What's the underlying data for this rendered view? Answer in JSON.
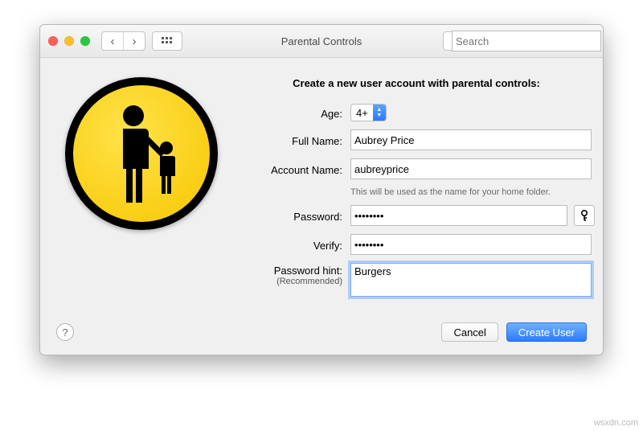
{
  "window": {
    "title": "Parental Controls",
    "search_placeholder": "Search"
  },
  "heading": "Create a new user account with parental controls:",
  "labels": {
    "age": "Age:",
    "full_name": "Full Name:",
    "account_name": "Account Name:",
    "account_hint": "This will be used as the name for your home folder.",
    "password": "Password:",
    "verify": "Verify:",
    "hint": "Password hint:",
    "hint_sub": "(Recommended)"
  },
  "values": {
    "age": "4+",
    "full_name": "Aubrey Price",
    "account_name": "aubreyprice",
    "password": "••••••••",
    "verify": "••••••••",
    "hint": "Burgers"
  },
  "buttons": {
    "cancel": "Cancel",
    "create": "Create User"
  },
  "watermark": "wsxdn.com"
}
